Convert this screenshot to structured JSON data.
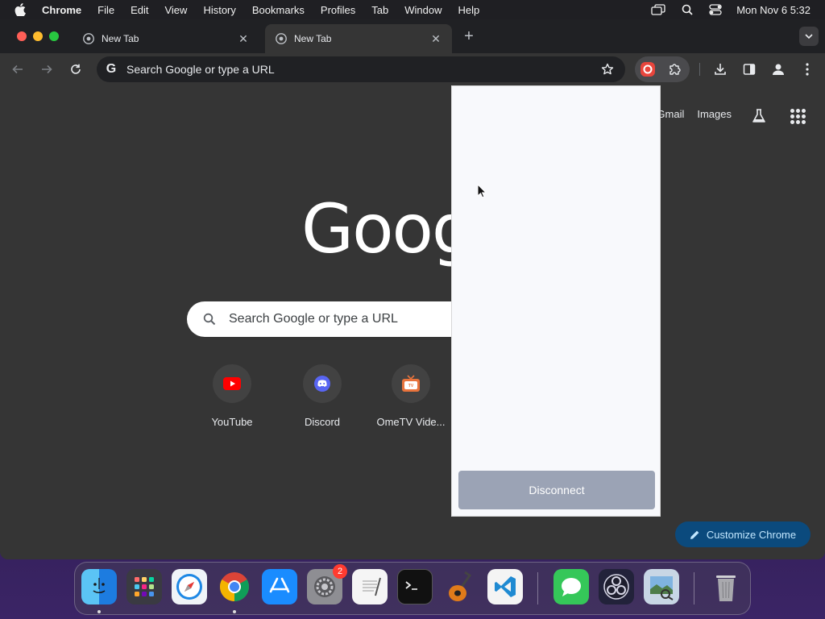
{
  "menubar": {
    "app_name": "Chrome",
    "items": [
      "File",
      "Edit",
      "View",
      "History",
      "Bookmarks",
      "Profiles",
      "Tab",
      "Window",
      "Help"
    ],
    "clock": "Mon Nov 6  5:32"
  },
  "tabs": [
    {
      "title": "New Tab",
      "active": false
    },
    {
      "title": "New Tab",
      "active": true
    }
  ],
  "toolbar": {
    "omnibox_placeholder": "Search Google or type a URL",
    "omnibox_g": "G"
  },
  "ntp": {
    "links": [
      "Gmail",
      "Images"
    ],
    "logo_text": "Google",
    "search_placeholder": "Search Google or type a URL",
    "shortcuts": [
      {
        "label": "YouTube",
        "icon": "youtube-icon"
      },
      {
        "label": "Discord",
        "icon": "discord-icon"
      },
      {
        "label": "OmeTV Vide...",
        "icon": "ometv-icon"
      }
    ],
    "customize_label": "Customize Chrome"
  },
  "popup": {
    "disconnect_label": "Disconnect"
  },
  "dock": {
    "apps": [
      "finder",
      "launchpad",
      "safari",
      "chrome",
      "app-store",
      "system-settings",
      "textedit",
      "terminal",
      "garageband",
      "vscode",
      "messages",
      "obs",
      "preview",
      "trash"
    ],
    "settings_badge": "2"
  },
  "colors": {
    "accent_blue": "#0b4a7d",
    "window_bg": "#353535",
    "popup_bg": "#f8f9fc",
    "disconnect_bg": "#9ba3b5"
  }
}
